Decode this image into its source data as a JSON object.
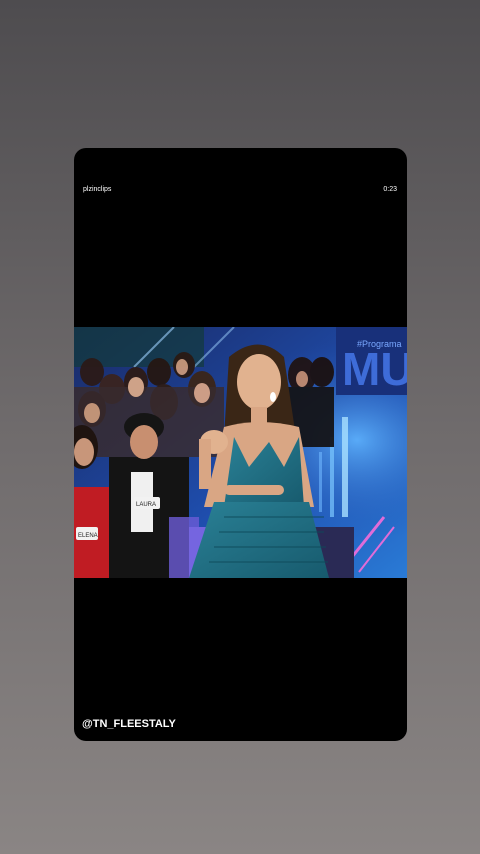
{
  "story": {
    "channel_name": "plzinclips",
    "duration": "0:23",
    "watermark": "@TN_FLEESTALY"
  },
  "video": {
    "screen_text": "#Programa",
    "name_tags": [
      "LAURA",
      "ELENA"
    ]
  },
  "colors": {
    "background": "#5f5b5c",
    "card": "#000000",
    "stage_blue": "#1e3a8a",
    "dress": "#1f6f86"
  }
}
